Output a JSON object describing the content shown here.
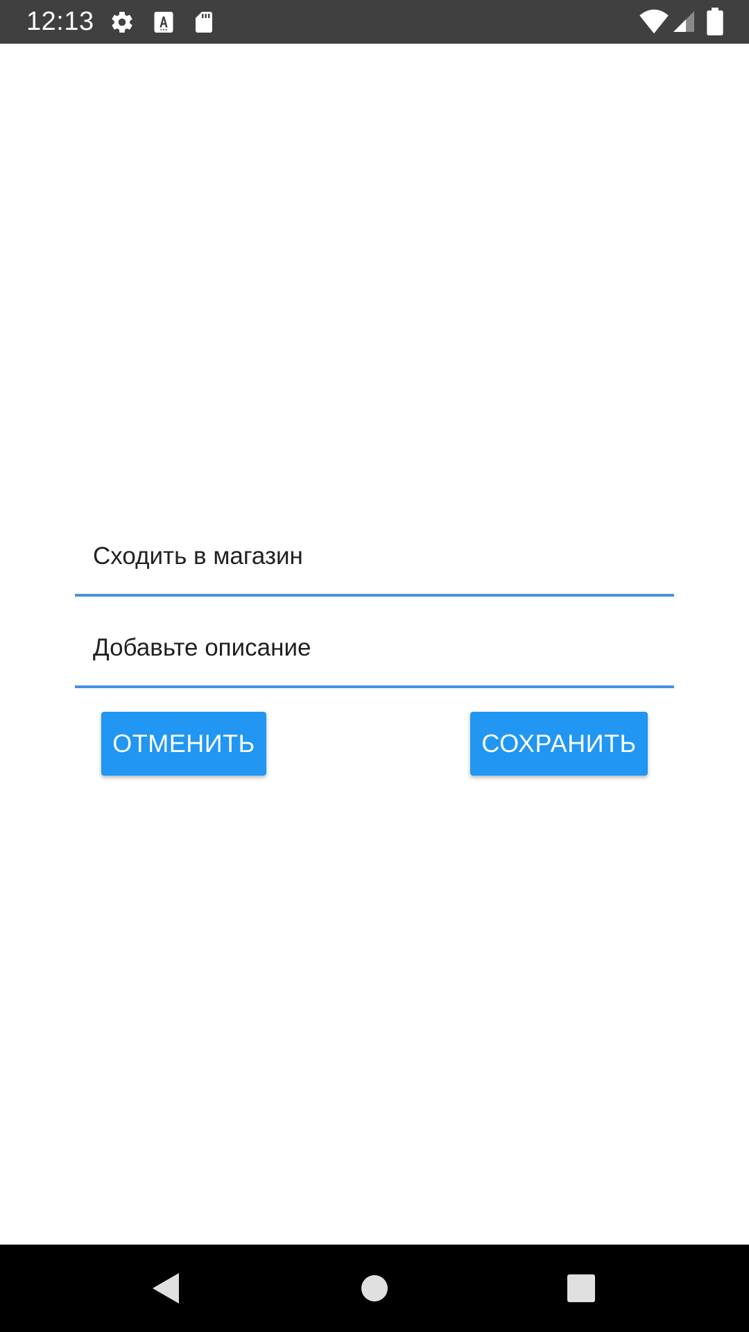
{
  "status_bar": {
    "time": "12:13",
    "icons": [
      "settings-icon",
      "a-notification-icon",
      "sd-card-icon",
      "wifi-icon",
      "signal-icon",
      "battery-icon"
    ]
  },
  "form": {
    "title_value": "Сходить в магазин",
    "description_placeholder": "Добавьте описание"
  },
  "buttons": {
    "cancel_label": "ОТМЕНИТЬ",
    "save_label": "СОХРАНИТЬ"
  },
  "nav_bar": {
    "icons": [
      "back-icon",
      "home-icon",
      "recents-icon"
    ]
  },
  "colors": {
    "accent": "#2196f3",
    "underline": "#4a90e2",
    "status_bar": "#404040",
    "nav_bar": "#000000"
  }
}
